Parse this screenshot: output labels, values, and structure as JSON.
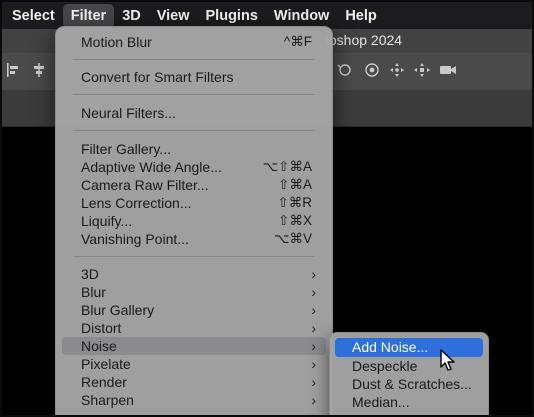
{
  "menubar": {
    "items": [
      {
        "label": "Select",
        "active": false
      },
      {
        "label": "Filter",
        "active": true
      },
      {
        "label": "3D",
        "active": false
      },
      {
        "label": "View",
        "active": false
      },
      {
        "label": "Plugins",
        "active": false
      },
      {
        "label": "Window",
        "active": false
      },
      {
        "label": "Help",
        "active": false
      }
    ]
  },
  "window": {
    "title_fragment": "toshop 2024"
  },
  "filter_menu": {
    "items": [
      {
        "label": "Motion Blur",
        "shortcut": "^⌘F"
      },
      {
        "label": "Convert for Smart Filters"
      },
      {
        "label": "Neural Filters..."
      },
      {
        "label": "Filter Gallery..."
      },
      {
        "label": "Adaptive Wide Angle...",
        "shortcut": "⌥⇧⌘A"
      },
      {
        "label": "Camera Raw Filter...",
        "shortcut": "⇧⌘A"
      },
      {
        "label": "Lens Correction...",
        "shortcut": "⇧⌘R"
      },
      {
        "label": "Liquify...",
        "shortcut": "⇧⌘X"
      },
      {
        "label": "Vanishing Point...",
        "shortcut": "⌥⌘V"
      },
      {
        "label": "3D",
        "submenu": true
      },
      {
        "label": "Blur",
        "submenu": true
      },
      {
        "label": "Blur Gallery",
        "submenu": true
      },
      {
        "label": "Distort",
        "submenu": true
      },
      {
        "label": "Noise",
        "submenu": true,
        "highlighted": true
      },
      {
        "label": "Pixelate",
        "submenu": true
      },
      {
        "label": "Render",
        "submenu": true
      },
      {
        "label": "Sharpen",
        "submenu": true
      }
    ]
  },
  "noise_submenu": {
    "items": [
      {
        "label": "Add Noise...",
        "selected": true
      },
      {
        "label": "Despeckle"
      },
      {
        "label": "Dust & Scratches..."
      },
      {
        "label": "Median..."
      }
    ]
  },
  "colors": {
    "menubar_bg": "#1c1c1e",
    "menu_bg": "#a4a4a4",
    "highlight": "#8b8b8e",
    "selection_blue": "#2f6fdb"
  },
  "icons": {
    "submenu_arrow": "chevron-right-icon",
    "cursor": "mouse-pointer-icon"
  }
}
